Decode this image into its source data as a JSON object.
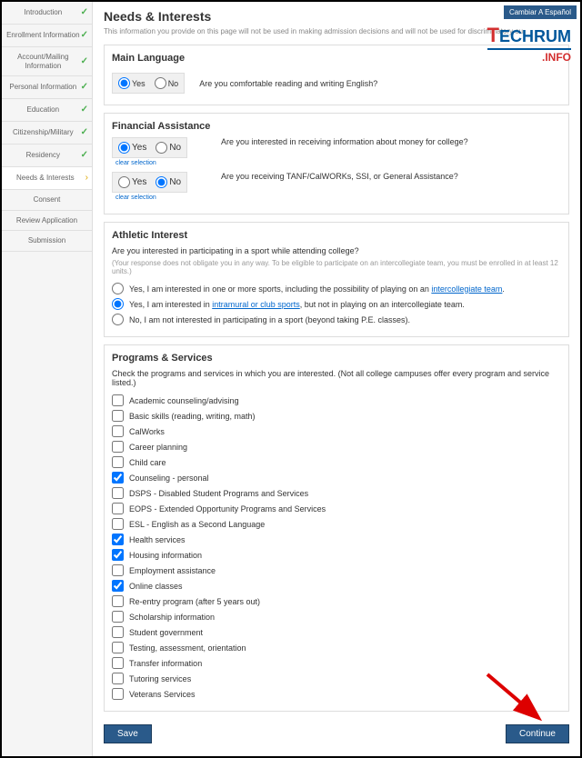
{
  "header": {
    "title": "Needs & Interests",
    "desc": "This information you provide on this page will not be used in making admission decisions and will not be used for discriminatory ou",
    "cambiar": "Cambiar A Español"
  },
  "sidebar": {
    "items": [
      {
        "label": "Introduction",
        "status": "done"
      },
      {
        "label": "Enrollment Information",
        "status": "done"
      },
      {
        "label": "Account/Mailing Information",
        "status": "done"
      },
      {
        "label": "Personal Information",
        "status": "done"
      },
      {
        "label": "Education",
        "status": "done"
      },
      {
        "label": "Citizenship/Military",
        "status": "done"
      },
      {
        "label": "Residency",
        "status": "done"
      },
      {
        "label": "Needs & Interests",
        "status": "current"
      },
      {
        "label": "Consent",
        "status": ""
      },
      {
        "label": "Review Application",
        "status": ""
      },
      {
        "label": "Submission",
        "status": ""
      }
    ]
  },
  "mainlang": {
    "title": "Main Language",
    "yes": "Yes",
    "no": "No",
    "q": "Are you comfortable reading and writing English?"
  },
  "fin": {
    "title": "Financial Assistance",
    "yes": "Yes",
    "no": "No",
    "q1": "Are you interested in receiving information about money for college?",
    "q2": "Are you receiving TANF/CalWORKs, SSI, or General Assistance?",
    "clear": "clear selection"
  },
  "athletic": {
    "title": "Athletic Interest",
    "q": "Are you interested in participating in a sport while attending college?",
    "note": "(Your response does not obligate you in any way. To be eligible to participate on an intercollegiate team, you must be enrolled in at least 12 units.)",
    "opt1a": "Yes, I am interested in one or more sports, including the possibility of playing on an ",
    "opt1b": "intercollegiate team",
    "opt1c": ".",
    "opt2a": "Yes, I am interested in ",
    "opt2b": "intramural or club sports",
    "opt2c": ", but not in playing on an intercollegiate team.",
    "opt3": "No, I am not interested in participating in a sport (beyond taking P.E. classes)."
  },
  "programs": {
    "title": "Programs & Services",
    "desc": "Check the programs and services in which you are interested. (Not all college campuses offer every program and service listed.)",
    "items": [
      {
        "label": "Academic counseling/advising",
        "checked": false
      },
      {
        "label": "Basic skills (reading, writing, math)",
        "checked": false
      },
      {
        "label": "CalWorks",
        "checked": false
      },
      {
        "label": "Career planning",
        "checked": false
      },
      {
        "label": "Child care",
        "checked": false
      },
      {
        "label": "Counseling - personal",
        "checked": true
      },
      {
        "label": "DSPS - Disabled Student Programs and Services",
        "checked": false
      },
      {
        "label": "EOPS - Extended Opportunity Programs and Services",
        "checked": false
      },
      {
        "label": "ESL - English as a Second Language",
        "checked": false
      },
      {
        "label": "Health services",
        "checked": true
      },
      {
        "label": "Housing information",
        "checked": true
      },
      {
        "label": "Employment assistance",
        "checked": false
      },
      {
        "label": "Online classes",
        "checked": true
      },
      {
        "label": "Re-entry program (after 5 years out)",
        "checked": false
      },
      {
        "label": "Scholarship information",
        "checked": false
      },
      {
        "label": "Student government",
        "checked": false
      },
      {
        "label": "Testing, assessment, orientation",
        "checked": false
      },
      {
        "label": "Transfer information",
        "checked": false
      },
      {
        "label": "Tutoring services",
        "checked": false
      },
      {
        "label": "Veterans Services",
        "checked": false
      }
    ]
  },
  "buttons": {
    "save": "Save",
    "continue": "Continue"
  },
  "logo": {
    "t": "T",
    "rest": "ECHRUM",
    "info": ".INFO"
  }
}
